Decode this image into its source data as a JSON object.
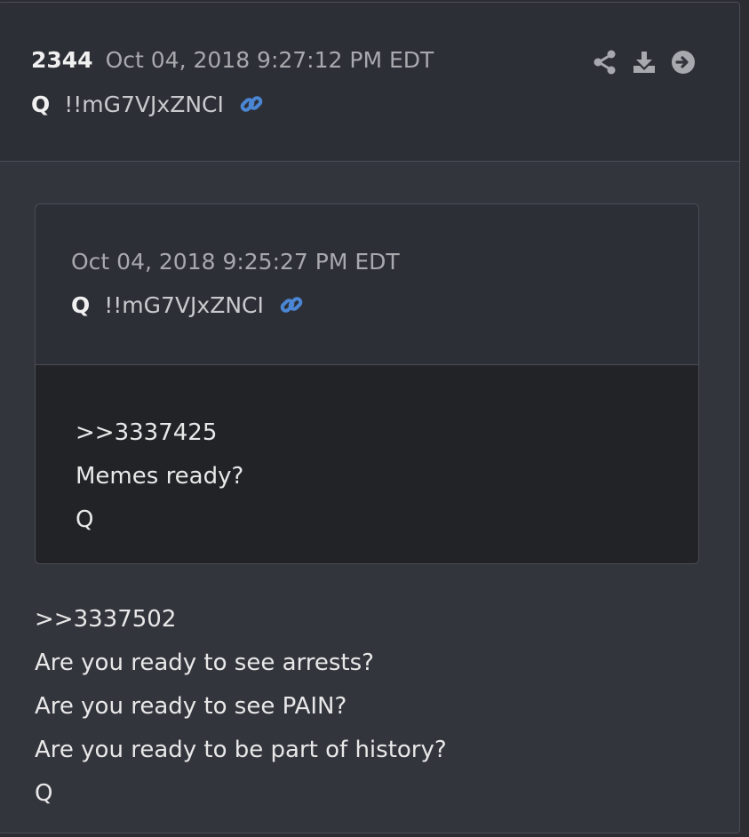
{
  "post": {
    "number": "2344",
    "timestamp": "Oct 04, 2018 9:27:12 PM EDT",
    "author": "Q",
    "tripcode": "!!mG7VJxZNCI",
    "actions": [
      "share-icon",
      "download-icon",
      "arrow-right-circle-icon"
    ]
  },
  "quoted_post": {
    "timestamp": "Oct 04, 2018 9:25:27 PM EDT",
    "author": "Q",
    "tripcode": "!!mG7VJxZNCI",
    "lines": [
      ">>3337425",
      "Memes ready?",
      "Q"
    ]
  },
  "body": {
    "lines": [
      ">>3337502",
      "Are you ready to see arrests?",
      "Are you ready to see PAIN?",
      "Are you ready to be part of history?",
      "Q"
    ]
  },
  "colors": {
    "link": "#4a86d4",
    "icon": "#a7a9ae"
  }
}
